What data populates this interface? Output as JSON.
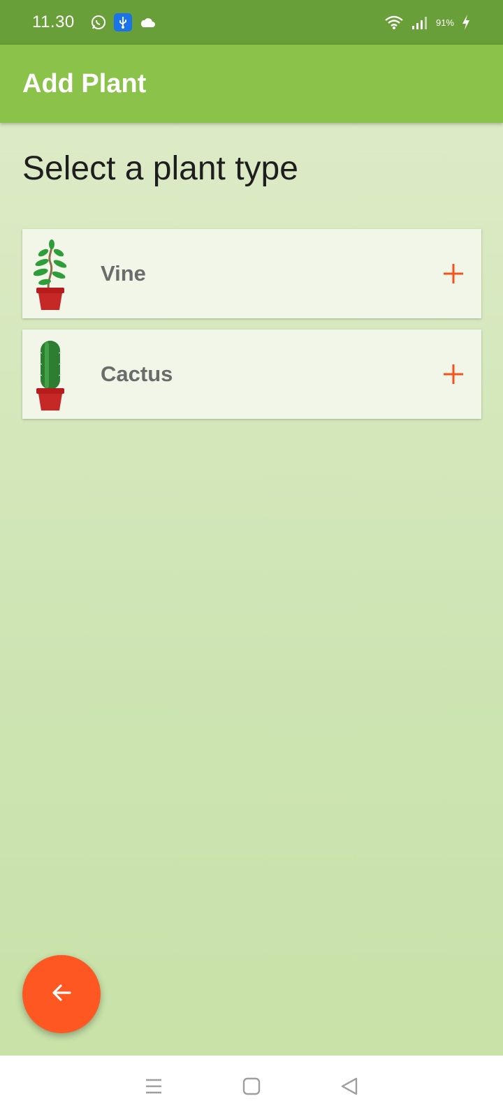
{
  "status_bar": {
    "time": "11.30",
    "battery": "91%",
    "icons": [
      "whatsapp-icon",
      "usb-icon",
      "cloud-icon",
      "wifi-icon",
      "signal-icon",
      "charging-icon"
    ]
  },
  "app_bar": {
    "title": "Add Plant"
  },
  "main": {
    "heading": "Select a plant type",
    "plant_types": [
      {
        "name": "Vine",
        "icon": "vine-plant-image",
        "action_icon": "plus-icon"
      },
      {
        "name": "Cactus",
        "icon": "cactus-plant-image",
        "action_icon": "plus-icon"
      }
    ]
  },
  "fab": {
    "icon": "arrow-back-icon"
  },
  "nav_bar": {
    "icons": [
      "recents-icon",
      "home-icon",
      "back-icon"
    ]
  },
  "colors": {
    "status_bar": "#689f38",
    "app_bar": "#8bc34a",
    "accent": "#ff5722",
    "card": "#f1f6e8",
    "background": "#d4e8bc"
  }
}
